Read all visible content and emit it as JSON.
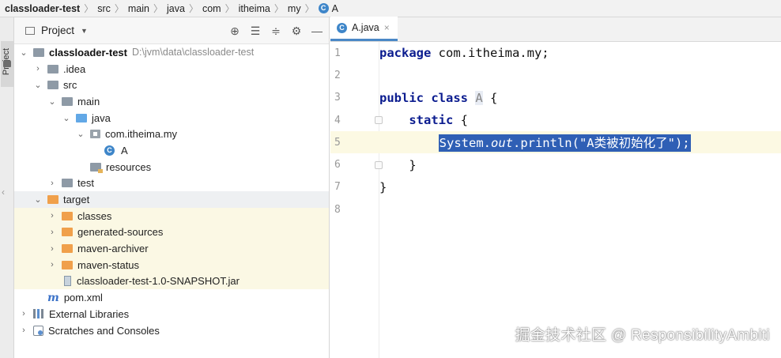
{
  "breadcrumb": [
    "classloader-test",
    "src",
    "main",
    "java",
    "com",
    "itheima",
    "my",
    "A"
  ],
  "strip": {
    "label": "Project"
  },
  "project": {
    "title": "Project",
    "tree": [
      {
        "label": "classloader-test",
        "path": "D:\\jvm\\data\\classloader-test"
      },
      {
        "label": ".idea"
      },
      {
        "label": "src"
      },
      {
        "label": "main"
      },
      {
        "label": "java"
      },
      {
        "label": "com.itheima.my"
      },
      {
        "label": "A"
      },
      {
        "label": "resources"
      },
      {
        "label": "test"
      },
      {
        "label": "target"
      },
      {
        "label": "classes"
      },
      {
        "label": "generated-sources"
      },
      {
        "label": "maven-archiver"
      },
      {
        "label": "maven-status"
      },
      {
        "label": "classloader-test-1.0-SNAPSHOT.jar"
      },
      {
        "label": "pom.xml"
      },
      {
        "label": "External Libraries"
      },
      {
        "label": "Scratches and Consoles"
      }
    ]
  },
  "editor": {
    "tab": "A.java",
    "lines": [
      {
        "n": "1"
      },
      {
        "n": "2"
      },
      {
        "n": "3"
      },
      {
        "n": "4"
      },
      {
        "n": "5"
      },
      {
        "n": "6"
      },
      {
        "n": "7"
      },
      {
        "n": "8"
      }
    ],
    "code": {
      "l1_kw": "package",
      "l1_rest": " com.itheima.my;",
      "l3_kw": "public class",
      "l3_cls": "A",
      "l3_rest": " {",
      "l4_kw": "static",
      "l4_rest": " {",
      "l5_a": "System.",
      "l5_b": "out",
      "l5_c": ".println(\"A类被初始化了\");",
      "l6": "}",
      "l7": "}"
    }
  },
  "watermark": "掘金技术社区 @ ResponsibilityAmbiti"
}
